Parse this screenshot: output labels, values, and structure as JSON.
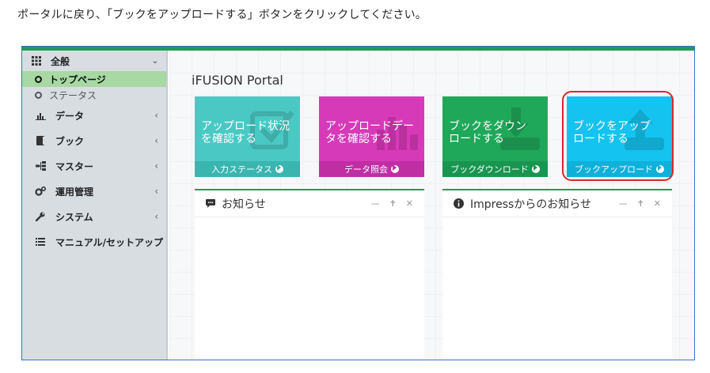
{
  "instruction": "ポータルに戻り、「ブックをアップロードする」ボタンをクリックしてください。",
  "sidebar": {
    "section": {
      "label": "全般"
    },
    "subitems": [
      {
        "label": "トップページ"
      },
      {
        "label": "ステータス"
      }
    ],
    "items": [
      {
        "label": "データ"
      },
      {
        "label": "ブック"
      },
      {
        "label": "マスター"
      },
      {
        "label": "運用管理"
      },
      {
        "label": "システム"
      },
      {
        "label": "マニュアル/セットアップ"
      }
    ]
  },
  "main": {
    "title": "iFUSION Portal",
    "tiles": [
      {
        "line1": "アップロード状況",
        "line2": "を確認する",
        "footer": "入力ステータス"
      },
      {
        "line1": "アップロードデー",
        "line2": "タを確認する",
        "footer": "データ照会"
      },
      {
        "line1": "ブックをダウン",
        "line2": "ロードする",
        "footer": "ブックダウンロード"
      },
      {
        "line1": "ブックをアップ",
        "line2": "ロードする",
        "footer": "ブックアップロード"
      }
    ],
    "panels": [
      {
        "title": "お知らせ"
      },
      {
        "title": "Impressからのお知らせ"
      }
    ]
  },
  "colors": {
    "accent_green": "#1b9e57",
    "tile_teal": "#4ac9c4",
    "tile_magenta": "#d73ab9",
    "tile_green": "#20a85a",
    "tile_blue": "#14c3ef",
    "highlight_red": "#d32a2a"
  }
}
